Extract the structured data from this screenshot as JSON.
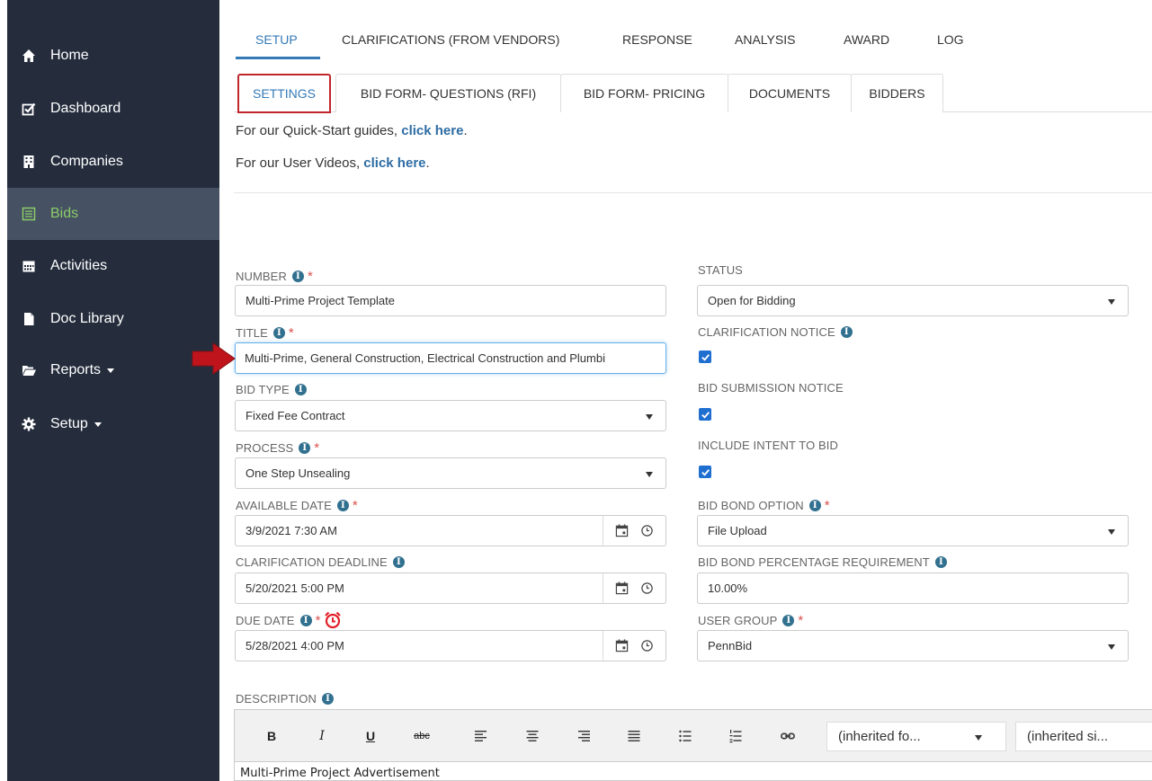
{
  "sidebar": {
    "items": [
      {
        "label": "Home",
        "icon": "home-icon"
      },
      {
        "label": "Dashboard",
        "icon": "check-square-icon"
      },
      {
        "label": "Companies",
        "icon": "building-icon"
      },
      {
        "label": "Bids",
        "icon": "list-icon",
        "active": true
      },
      {
        "label": "Activities",
        "icon": "calendar-icon"
      },
      {
        "label": "Doc Library",
        "icon": "file-icon"
      },
      {
        "label": "Reports",
        "icon": "folder-open-icon"
      },
      {
        "label": "Setup",
        "icon": "gear-icon"
      }
    ]
  },
  "top_tabs": [
    "SETUP",
    "CLARIFICATIONS (FROM VENDORS)",
    "RESPONSE",
    "ANALYSIS",
    "AWARD",
    "LOG"
  ],
  "sub_tabs": [
    "SETTINGS",
    "BID FORM- QUESTIONS (RFI)",
    "BID FORM- PRICING",
    "DOCUMENTS",
    "BIDDERS"
  ],
  "help": {
    "guides_prefix": "For our Quick-Start guides, ",
    "guides_link": "click here",
    "videos_prefix": "For our User Videos, ",
    "videos_link": "click here",
    "period": "."
  },
  "form": {
    "number_label": "NUMBER",
    "number_value": "Multi-Prime Project Template",
    "title_label": "TITLE",
    "title_value": "Multi-Prime, General Construction, Electrical Construction and Plumbi",
    "bid_type_label": "BID TYPE",
    "bid_type_value": "Fixed Fee Contract",
    "process_label": "PROCESS",
    "process_value": "One Step Unsealing",
    "available_date_label": "AVAILABLE DATE",
    "available_date_value": "3/9/2021 7:30 AM",
    "clarification_deadline_label": "CLARIFICATION DEADLINE",
    "clarification_deadline_value": "5/20/2021 5:00 PM",
    "due_date_label": "DUE DATE",
    "due_date_value": "5/28/2021 4:00 PM",
    "status_label": "STATUS",
    "status_value": "Open for Bidding",
    "clarification_notice_label": "CLARIFICATION NOTICE",
    "clarification_notice_checked": true,
    "bid_submission_notice_label": "BID SUBMISSION NOTICE",
    "bid_submission_notice_checked": true,
    "intent_to_bid_label": "INCLUDE INTENT TO BID",
    "intent_to_bid_checked": true,
    "bid_bond_option_label": "BID BOND OPTION",
    "bid_bond_option_value": "File Upload",
    "bid_bond_pct_label": "BID BOND PERCENTAGE REQUIREMENT",
    "bid_bond_pct_value": "10.00%",
    "user_group_label": "USER GROUP",
    "user_group_value": "PennBid",
    "description_label": "DESCRIPTION",
    "required_mark": "*",
    "info_glyph": "i"
  },
  "editor": {
    "bold": "B",
    "italic": "I",
    "underline": "U",
    "strike": "abc",
    "font_select": "(inherited fo...",
    "size_select": "(inherited si...",
    "body_text": "Multi-Prime Project Advertisement"
  },
  "colors": {
    "sidebar_bg": "#252d3d",
    "sidebar_active_bg": "#465263",
    "active_text": "#8ccb6a",
    "accent_blue": "#337ab7",
    "required_red": "#d9534f",
    "highlight_border": "#c0262c",
    "pointer_arrow": "#c0141c"
  }
}
